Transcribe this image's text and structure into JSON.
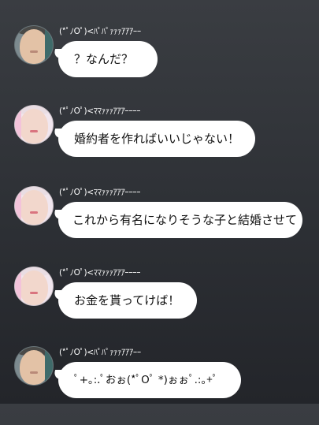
{
  "messages": [
    {
      "sender": "(*ﾟﾉOﾟ)<ﾊﾟﾊﾟｧｧｧｱｱｱｰｰ",
      "avatar": "father-avatar",
      "text": "？なんだ？"
    },
    {
      "sender": "(*ﾟﾉOﾟ)<ﾏﾏｧｧｧｱｱｱｰｰｰｰ",
      "avatar": "mother-avatar",
      "text": "婚約者を作ればいいじゃない！"
    },
    {
      "sender": "(*ﾟﾉOﾟ)<ﾏﾏｧｧｧｱｱｱｰｰｰｰ",
      "avatar": "mother-avatar",
      "text": "これから有名になりそうな子と結婚させて"
    },
    {
      "sender": "(*ﾟﾉOﾟ)<ﾏﾏｧｧｧｱｱｱｰｰｰｰ",
      "avatar": "mother-avatar",
      "text": "お金を貰ってけば！"
    },
    {
      "sender": "(*ﾟﾉOﾟ)<ﾊﾟﾊﾟｧｧｧｱｱｱｰｰ",
      "avatar": "father-avatar",
      "text": "ﾟ+｡:.ﾟおぉ(*ﾟOﾟ *)ぉぉﾟ.:｡+ﾟ"
    }
  ]
}
